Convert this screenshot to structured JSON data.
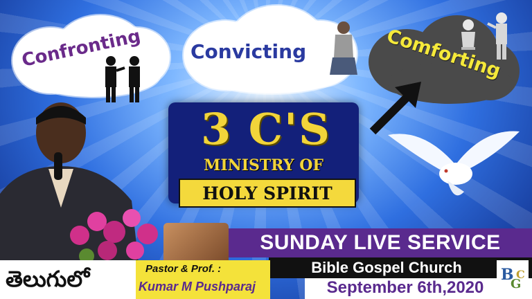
{
  "clouds": {
    "left": "Confronting",
    "center": "Convicting",
    "right": "Comforting"
  },
  "title": {
    "main": "3 C'S",
    "line2": "MINISTRY OF",
    "line3": "HOLY SPIRIT"
  },
  "banner": {
    "service": "SUNDAY LIVE SERVICE",
    "church": "Bible Gospel Church",
    "date": "September 6th,2020"
  },
  "language_label": "తెలుగులో",
  "pastor": {
    "title": "Pastor & Prof. :",
    "name": "Kumar M Pushparaj"
  },
  "colors": {
    "purple": "#5a2a8e",
    "gold": "#f2d43a",
    "navy": "#13207a",
    "yellow": "#f4e23a"
  }
}
